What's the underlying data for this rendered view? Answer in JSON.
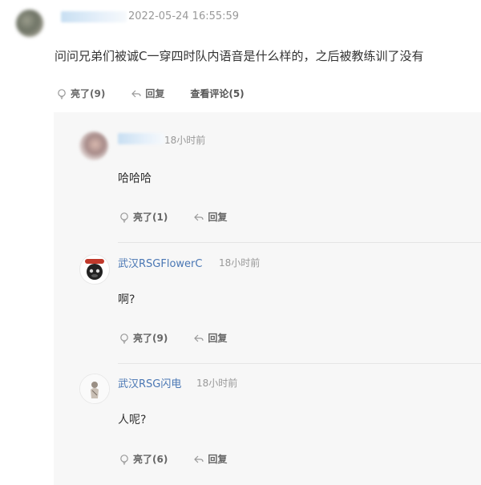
{
  "post": {
    "time": "2022-05-24 16:55:59",
    "text": "问问兄弟们被诚C一穿四时队内语音是什么样的，之后被教练训了没有",
    "like_label": "亮了(9)",
    "reply_label": "回复",
    "view_comments_label": "查看评论(5)"
  },
  "replies": [
    {
      "time": "18小时前",
      "text": "哈哈哈",
      "like_label": "亮了(1)",
      "reply_label": "回复"
    },
    {
      "name": "武汉RSGFlowerC",
      "time": "18小时前",
      "text": "啊?",
      "like_label": "亮了(9)",
      "reply_label": "回复"
    },
    {
      "name": "武汉RSG闪电",
      "time": "18小时前",
      "text": "人呢?",
      "like_label": "亮了(6)",
      "reply_label": "回复"
    }
  ],
  "colors": {
    "link_blue": "#4a77b4",
    "panel_bg": "#f7f7f7",
    "muted": "#999999"
  },
  "icons": [
    "like-icon",
    "reply-icon"
  ]
}
